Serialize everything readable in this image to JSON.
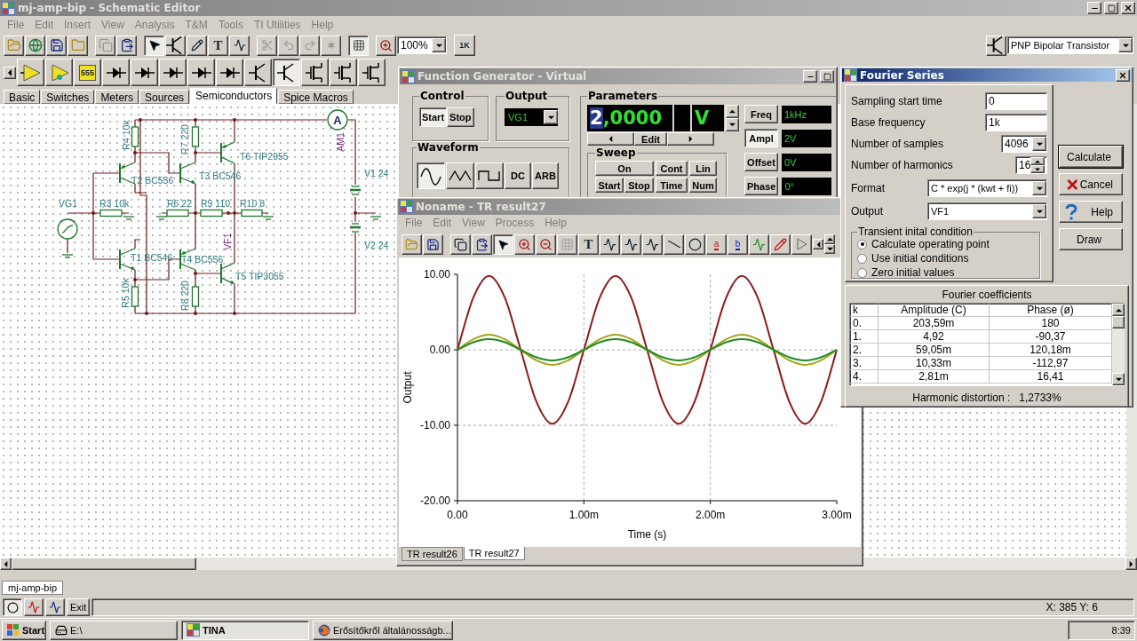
{
  "window": {
    "title": "mj-amp-bip - Schematic Editor"
  },
  "menu": [
    "File",
    "Edit",
    "Insert",
    "View",
    "Analysis",
    "T&M",
    "Tools",
    "TI Utilities",
    "Help"
  ],
  "toolbar": {
    "pointer_tool_selected": true,
    "grid_on": true,
    "text_tool_label": "T",
    "zoom": "100%",
    "part_icon_text": "1K",
    "part_selector": "PNP Bipolar Transistor"
  },
  "component_bar": {
    "chip_text": "555"
  },
  "component_tabs": [
    {
      "label": "Basic",
      "selected": false
    },
    {
      "label": "Switches",
      "selected": false
    },
    {
      "label": "Meters",
      "selected": false
    },
    {
      "label": "Sources",
      "selected": false
    },
    {
      "label": "Semiconductors",
      "selected": true
    },
    {
      "label": "Spice Macros",
      "selected": false
    }
  ],
  "schematic": {
    "ammeter_letter": "A",
    "labels": [
      {
        "text": "R4 10k",
        "kind": "part"
      },
      {
        "text": "R7 220",
        "kind": "part"
      },
      {
        "text": "T6 TIP2955",
        "kind": "part"
      },
      {
        "text": "AM1",
        "kind": "probe"
      },
      {
        "text": "T2 BC556",
        "kind": "part"
      },
      {
        "text": "T3 BC546",
        "kind": "part"
      },
      {
        "text": "V1 24",
        "kind": "part"
      },
      {
        "text": "VG1",
        "kind": "part"
      },
      {
        "text": "R3 10k",
        "kind": "part"
      },
      {
        "text": "R6 22",
        "kind": "part"
      },
      {
        "text": "R9 110",
        "kind": "part"
      },
      {
        "text": "R10 8",
        "kind": "part"
      },
      {
        "text": "VF1",
        "kind": "probe"
      },
      {
        "text": "T1 BC546",
        "kind": "part"
      },
      {
        "text": "T4 BC556",
        "kind": "part"
      },
      {
        "text": "V2 24",
        "kind": "part"
      },
      {
        "text": "T5 TIP3055",
        "kind": "part"
      },
      {
        "text": "R5 10k",
        "kind": "part"
      },
      {
        "text": "R8 220",
        "kind": "part"
      }
    ]
  },
  "function_generator": {
    "title": "Function Generator - Virtual",
    "control": {
      "title": "Control",
      "buttons": [
        {
          "label": "Start",
          "selected": true
        },
        {
          "label": "Stop",
          "selected": false
        }
      ]
    },
    "output": {
      "title": "Output",
      "value": "VG1"
    },
    "waveform": {
      "title": "Waveform",
      "buttons": [
        {
          "kind": "sine",
          "selected": true
        },
        {
          "kind": "triangle",
          "selected": false
        },
        {
          "kind": "square",
          "selected": false
        },
        {
          "kind": "text",
          "label": "DC",
          "selected": false
        },
        {
          "kind": "text",
          "label": "ARB",
          "selected": false
        }
      ]
    },
    "parameters": {
      "title": "Parameters",
      "display": {
        "cursor_digit": "2",
        "rest": ",0000",
        "unit": "V"
      },
      "edit": "Edit",
      "sweep": {
        "title": "Sweep",
        "buttons": [
          "On",
          "Cont",
          "Lin",
          "Start",
          "Stop",
          "Time",
          "Num"
        ]
      },
      "settings": [
        {
          "label": "Freq",
          "value": "1kHz",
          "selected": false
        },
        {
          "label": "Ampl",
          "value": "2V",
          "selected": true
        },
        {
          "label": "Offset",
          "value": "0V",
          "selected": false
        },
        {
          "label": "Phase",
          "value": "0°",
          "selected": false
        }
      ]
    }
  },
  "result_window": {
    "title": "Noname - TR result27",
    "menu": [
      "File",
      "Edit",
      "View",
      "Process",
      "Help"
    ],
    "pointer_tool_selected": true,
    "text_tool_label": "T",
    "marker_a": "a",
    "marker_b": "b",
    "chart_data": {
      "type": "line",
      "grid": true,
      "xlabel": "Time (s)",
      "ylabel": "Output",
      "xlim": [
        0,
        3
      ],
      "ylim": [
        -20,
        10
      ],
      "xticks": [
        {
          "value": 0,
          "label": "0.00"
        },
        {
          "value": 1,
          "label": "1.00m"
        },
        {
          "value": 2,
          "label": "2.00m"
        },
        {
          "value": 3,
          "label": "3.00m"
        }
      ],
      "yticks": [
        {
          "value": 10,
          "label": "10.00"
        },
        {
          "value": 0,
          "label": "0.00"
        },
        {
          "value": -10,
          "label": "-10.00"
        },
        {
          "value": -20,
          "label": "-20.00"
        }
      ],
      "x": [
        0,
        0.125,
        0.25,
        0.375,
        0.5,
        0.625,
        0.75,
        0.875,
        1,
        1.125,
        1.25,
        1.375,
        1.5,
        1.625,
        1.75,
        1.875,
        2,
        2.125,
        2.25,
        2.375,
        2.5,
        2.625,
        2.75,
        2.875,
        3
      ],
      "series": [
        {
          "color": "#8b1a1a",
          "values": [
            0,
            6.9,
            9.8,
            6.9,
            0,
            -6.9,
            -9.8,
            -6.9,
            0,
            6.9,
            9.8,
            6.9,
            0,
            -6.9,
            -9.8,
            -6.9,
            0,
            6.9,
            9.8,
            6.9,
            0,
            -6.9,
            -9.8,
            -6.9,
            0
          ]
        },
        {
          "color": "#a3a31e",
          "values": [
            0,
            1.4,
            2,
            1.4,
            0,
            -1.4,
            -2,
            -1.4,
            0,
            1.4,
            2,
            1.4,
            0,
            -1.4,
            -2,
            -1.4,
            0,
            1.4,
            2,
            1.4,
            0,
            -1.4,
            -2,
            -1.4,
            0
          ]
        },
        {
          "color": "#1e8c1e",
          "values": [
            0,
            1,
            1.4,
            1,
            0,
            -1,
            -1.4,
            -1,
            0,
            1,
            1.4,
            1,
            0,
            -1,
            -1.4,
            -1,
            0,
            1,
            1.4,
            1,
            0,
            -1,
            -1.4,
            -1,
            0
          ]
        }
      ]
    },
    "tabs": [
      {
        "label": "TR result26",
        "selected": false
      },
      {
        "label": "TR result27",
        "selected": true
      }
    ]
  },
  "fourier": {
    "title": "Fourier Series",
    "fields": [
      {
        "label": "Sampling start time",
        "value": "0",
        "kind": "text"
      },
      {
        "label": "Base frequency",
        "value": "1k",
        "kind": "text"
      },
      {
        "label": "Number of samples",
        "value": "4096",
        "kind": "dropdown"
      },
      {
        "label": "Number of harmonics",
        "value": "16",
        "kind": "spinner"
      },
      {
        "label": "Format",
        "value": "C * exp(j * (kwt + fi))",
        "kind": "wide-dropdown"
      },
      {
        "label": "Output",
        "value": "VF1",
        "kind": "wide-dropdown"
      }
    ],
    "initial_condition": {
      "title": "Transient inital condition",
      "options": [
        {
          "label": "Calculate operating point",
          "selected": true
        },
        {
          "label": "Use initial conditions",
          "selected": false
        },
        {
          "label": "Zero initial values",
          "selected": false
        }
      ]
    },
    "buttons": [
      {
        "label": "Calculate",
        "kind": "default"
      },
      {
        "label": "Cancel",
        "kind": "cancel"
      },
      {
        "label": "Help",
        "kind": "help"
      },
      {
        "label": "Draw",
        "kind": "plain"
      }
    ],
    "coefficients": {
      "title": "Fourier coefficients",
      "columns": [
        "k",
        "Amplitude (C)",
        "Phase (ø)"
      ],
      "rows": [
        [
          "0.",
          "203,59m",
          "180"
        ],
        [
          "1.",
          "4,92",
          "-90,37"
        ],
        [
          "2.",
          "59,05m",
          "120,18m"
        ],
        [
          "3.",
          "10,33m",
          "-112,97"
        ],
        [
          "4.",
          "2,81m",
          "16,41"
        ]
      ]
    },
    "distortion_label": "Harmonic distortion :",
    "distortion_value": "1,2733%"
  },
  "document_tabs": [
    {
      "label": "mj-amp-bip",
      "selected": true
    }
  ],
  "bottom_toolbar": {
    "exit": "Exit"
  },
  "status_bar": {
    "coordinates": "X: 385 Y: 6"
  },
  "taskbar": {
    "start": "Start",
    "items": [
      {
        "label": "E:\\",
        "kind": "drive",
        "selected": false
      },
      {
        "label": "TINA",
        "kind": "app",
        "selected": true
      },
      {
        "label": "Erősítőkről általánosságb...",
        "kind": "browser",
        "selected": false
      }
    ],
    "clock": "8:39"
  }
}
